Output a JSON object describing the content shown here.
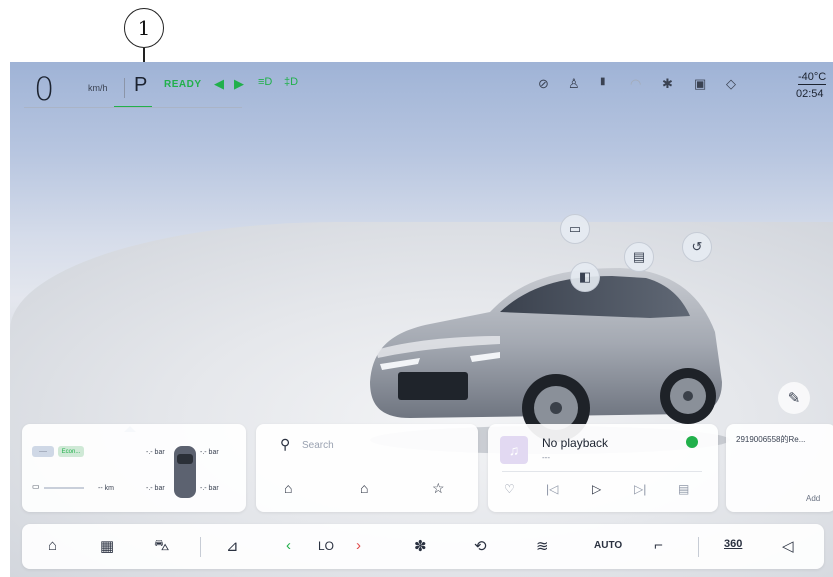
{
  "callout": {
    "number": "1"
  },
  "status": {
    "speed": "0",
    "speed_unit": "km/h",
    "gear": "P",
    "ready": "READY",
    "temperature": "-40°C",
    "time": "02:54",
    "colors": {
      "ready_green": "#21b04b",
      "text": "#1c2330"
    }
  },
  "icons": {
    "left_turn": "◀",
    "right_turn": "▶",
    "low_beam": "≡D",
    "fog_light": "‡D",
    "camera_off": "⊘",
    "user": "♙",
    "signal": "▮",
    "wifi": "◠",
    "bluetooth": "✱",
    "screen": "▣",
    "shield": "◇"
  },
  "car": {
    "hotspots": {
      "sunroof": "▭",
      "window": "▤",
      "mirror": "◧",
      "charge_port": "↺"
    }
  },
  "tyres": {
    "mode_pill": "----",
    "eco_pill": "Econ...",
    "front_left": "-.- bar",
    "front_right": "-.- bar",
    "rear_left": "-.- bar",
    "rear_right": "-.- bar",
    "range": "-- km"
  },
  "search": {
    "placeholder": "Search"
  },
  "media": {
    "title": "No playback",
    "artist": "---"
  },
  "note": {
    "text": "2919006558的Re...",
    "add": "Add"
  },
  "dock": {
    "temperature_setting": "LO",
    "auto": "AUTO",
    "view360": "360"
  }
}
